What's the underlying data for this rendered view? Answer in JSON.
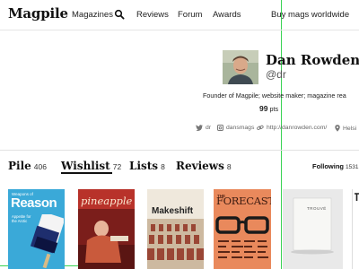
{
  "nav": {
    "logo": "Magpile",
    "items": [
      "Magazines",
      "Reviews",
      "Forum",
      "Awards"
    ],
    "buy": "Buy mags worldwide"
  },
  "profile": {
    "name": "Dan Rowden",
    "handle": "@dr",
    "bio": "Founder of Magpile; website maker; magazine rea",
    "points_value": "99",
    "points_unit": "pts",
    "social": {
      "twitter": "dr",
      "instagram": "dansmags",
      "website": "http://danrowden.com/",
      "location": "Helsi"
    }
  },
  "tabs": [
    {
      "label": "Pile",
      "count": "406"
    },
    {
      "label": "Wishlist",
      "count": "72"
    },
    {
      "label": "Lists",
      "count": "8"
    },
    {
      "label": "Reviews",
      "count": "8"
    }
  ],
  "following": {
    "label": "Following",
    "count": "1531"
  },
  "magazines": [
    {
      "title": "Reason",
      "kicker": "Weapons of",
      "sub": "Appetite for the Arctic",
      "bg": "#3aa9d8"
    },
    {
      "title": "pineapple",
      "bg": "#c9322b"
    },
    {
      "title": "Makeshift",
      "bg": "#efe8dc"
    },
    {
      "title": "FORECAST",
      "kicker": "THE",
      "bg": "#e9895c"
    },
    {
      "title": "TROUVÉ",
      "bg": "#e2e2e2"
    },
    {
      "title": "",
      "bg": "#ffffff"
    }
  ],
  "colors": {
    "guide": "#39d353",
    "text": "#222222",
    "border": "#e2e2e2"
  }
}
